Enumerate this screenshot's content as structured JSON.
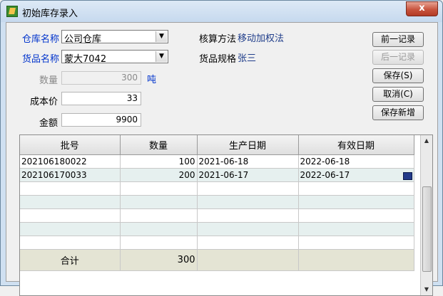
{
  "window": {
    "title": "初始库存录入",
    "close_label": "x"
  },
  "form": {
    "warehouse_label": "仓库名称",
    "warehouse_value": "公司仓库",
    "goods_label": "货品名称",
    "goods_value": "蒙大7042",
    "quantity_label": "数量",
    "quantity_value": "300",
    "quantity_unit": "吨",
    "cost_label": "成本价",
    "cost_value": "33",
    "amount_label": "金额",
    "amount_value": "9900",
    "method_label": "核算方法",
    "method_value": "移动加权法",
    "spec_label": "货品规格",
    "spec_value": "张三"
  },
  "buttons": {
    "prev": "前一记录",
    "next": "后一记录",
    "save": "保存(S)",
    "cancel": "取消(C)",
    "save_new": "保存新增"
  },
  "grid": {
    "columns": [
      "批号",
      "数量",
      "生产日期",
      "有效日期"
    ],
    "rows": [
      [
        "202106180022",
        "100",
        "2021-06-18",
        "2022-06-18"
      ],
      [
        "202106170033",
        "200",
        "2021-06-17",
        "2022-06-17"
      ]
    ],
    "total_label": "合计",
    "total_value": "300"
  }
}
